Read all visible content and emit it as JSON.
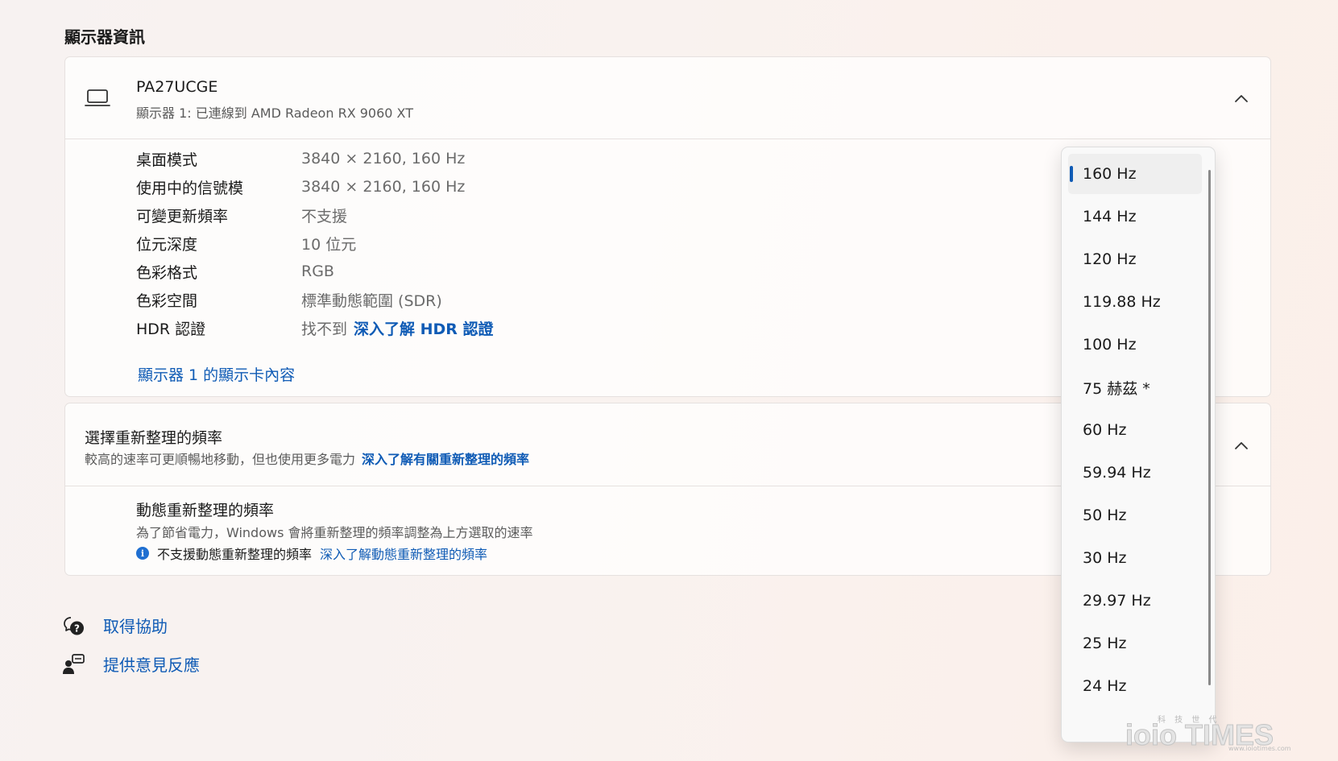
{
  "section_title": "顯示器資訊",
  "monitor": {
    "name": "PA27UCGE",
    "subtitle": "顯示器 1: 已連線到 AMD Radeon RX 9060 XT",
    "rows": [
      {
        "label": "桌面模式",
        "value": "3840 × 2160, 160 Hz"
      },
      {
        "label": "使用中的信號模",
        "value": "3840 × 2160, 160 Hz"
      },
      {
        "label": "可變更新頻率",
        "value": "不支援"
      },
      {
        "label": "位元深度",
        "value": "10 位元"
      },
      {
        "label": "色彩格式",
        "value": "RGB"
      },
      {
        "label": "色彩空間",
        "value": "標準動態範圍 (SDR)"
      }
    ],
    "hdr_label": "HDR 認證",
    "hdr_value": "找不到",
    "hdr_link": "深入了解 HDR 認證",
    "adapter_link": "顯示器 1 的顯示卡內容"
  },
  "refresh": {
    "title": "選擇重新整理的頻率",
    "desc": "較高的速率可更順暢地移動，但也使用更多電力",
    "desc_link": "深入了解有關重新整理的頻率",
    "dynamic_title": "動態重新整理的頻率",
    "dynamic_desc": "為了節省電力，Windows 會將重新整理的頻率調整為上方選取的速率",
    "dynamic_note": "不支援動態重新整理的頻率",
    "dynamic_link": "深入了解動態重新整理的頻率"
  },
  "bottom_links": {
    "help": "取得協助",
    "feedback": "提供意見反應"
  },
  "dropdown": {
    "selected_index": 0,
    "options": [
      "160 Hz",
      "144 Hz",
      "120 Hz",
      "119.88 Hz",
      "100 Hz",
      "75 赫茲 *",
      "60 Hz",
      "59.94 Hz",
      "50 Hz",
      "30 Hz",
      "29.97 Hz",
      "25 Hz",
      "24 Hz"
    ]
  },
  "watermark": {
    "logo": "ioio TIMES",
    "tagline": "科 技 世 代",
    "url": "www.ioiotimes.com"
  },
  "colors": {
    "accent": "#0f5bb5",
    "info": "#1f6fd1"
  },
  "icons": {
    "monitor": "laptop-icon",
    "collapse": "chevron-up-icon",
    "help": "help-chat-icon",
    "feedback": "feedback-person-icon",
    "info": "info-icon"
  }
}
